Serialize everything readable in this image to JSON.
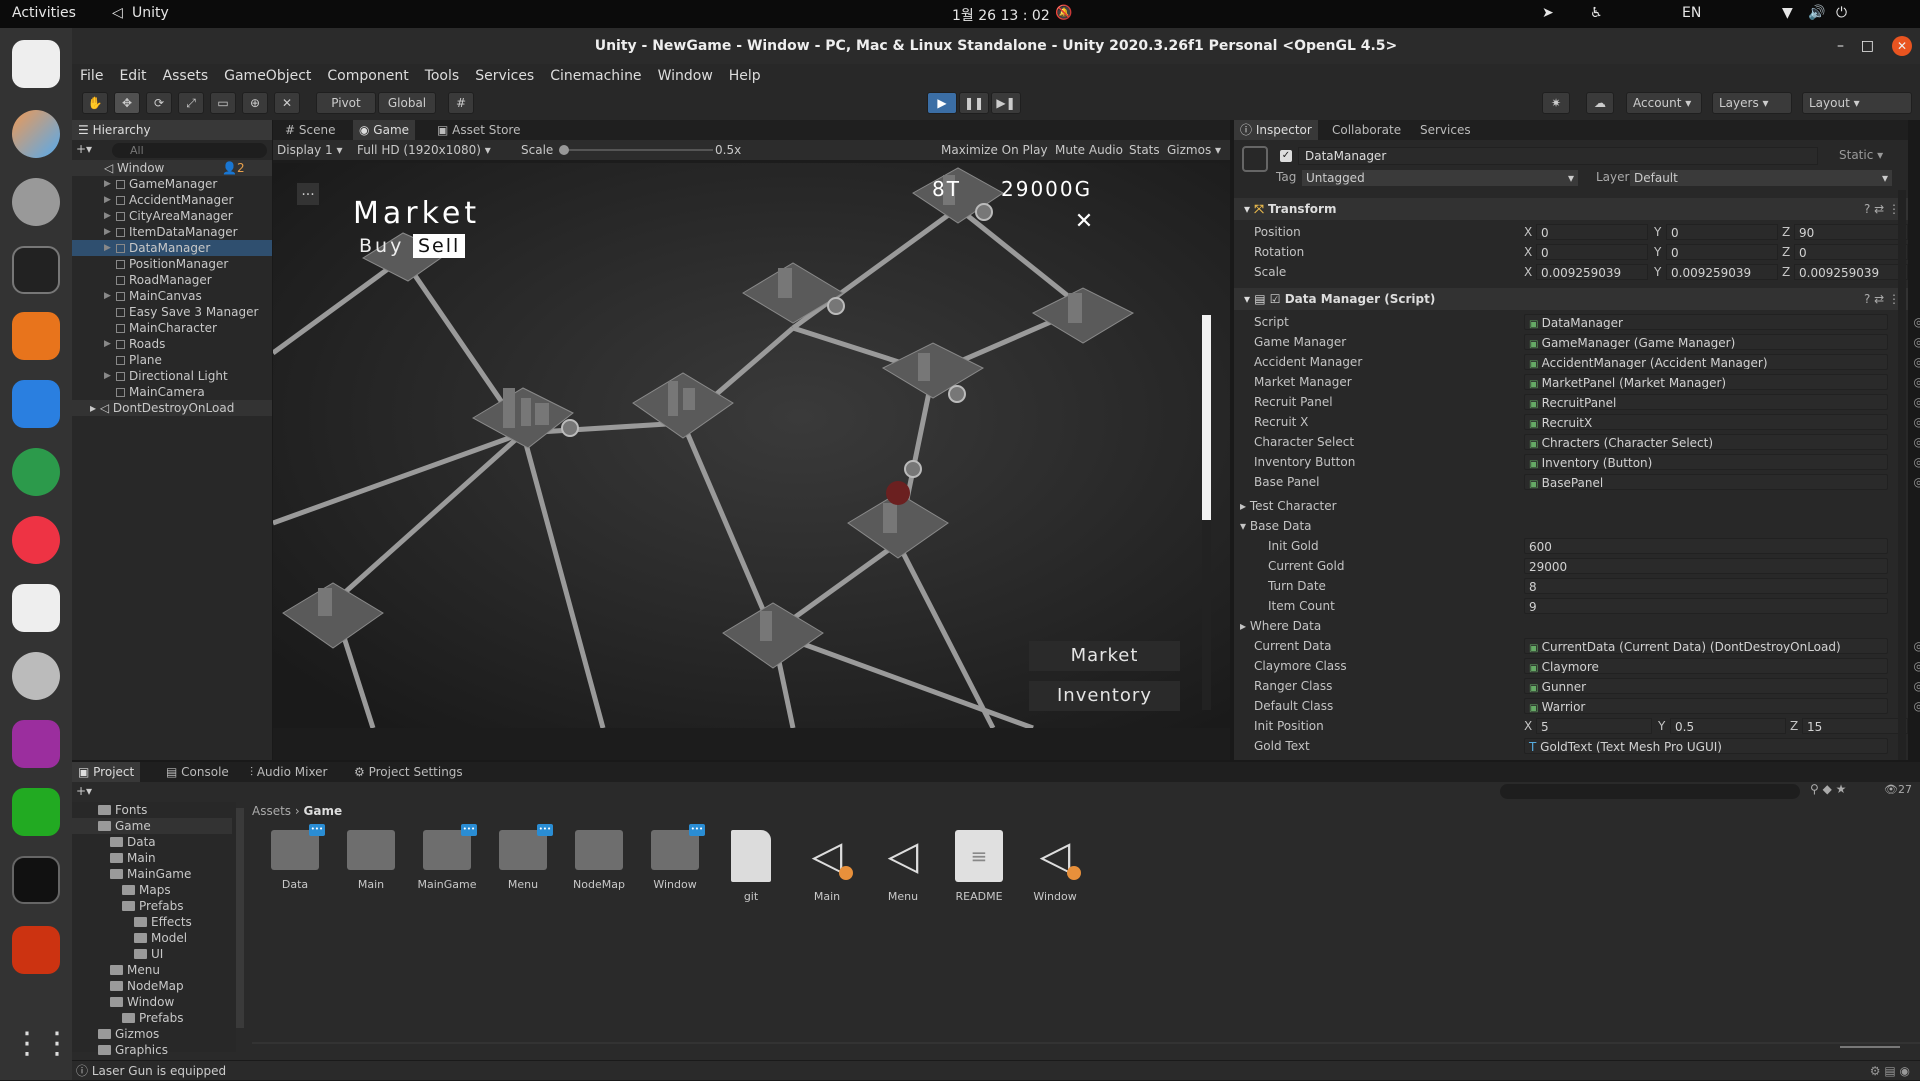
{
  "topbar": {
    "activities": "Activities",
    "app": "Unity",
    "clock": "1월 26 13 : 02",
    "lang": "EN"
  },
  "window": {
    "title": "Unity - NewGame - Window - PC, Mac & Linux Standalone - Unity 2020.3.26f1 Personal <OpenGL 4.5>"
  },
  "menu": [
    "File",
    "Edit",
    "Assets",
    "GameObject",
    "Component",
    "Tools",
    "Services",
    "Cinemachine",
    "Window",
    "Help"
  ],
  "toolbar": {
    "pivot": "Pivot",
    "global": "Global",
    "account": "Account",
    "layers": "Layers",
    "layout": "Layout"
  },
  "hierarchy": {
    "tab": "Hierarchy",
    "search": "All",
    "scene": "Window",
    "scene_badge": "2",
    "items": [
      "GameManager",
      "AccidentManager",
      "CityAreaManager",
      "ItemDataManager",
      "DataManager",
      "PositionManager",
      "RoadManager",
      "MainCanvas",
      "Easy Save 3 Manager",
      "MainCharacter",
      "Roads",
      "Plane",
      "Directional Light",
      "MainCamera"
    ],
    "dont_destroy": "DontDestroyOnLoad"
  },
  "game": {
    "tabs": [
      "Scene",
      "Game",
      "Asset Store"
    ],
    "display": "Display 1",
    "resolution": "Full HD (1920x1080)",
    "scale_label": "Scale",
    "scale_value": "0.5x",
    "options": [
      "Maximize On Play",
      "Mute Audio",
      "Stats",
      "Gizmos"
    ],
    "market_title": "Market",
    "buy": "Buy",
    "sell": "Sell",
    "turn": "8T",
    "gold": "29000G",
    "market_btn": "Market",
    "inventory_btn": "Inventory",
    "dots": "..."
  },
  "inspector": {
    "tabs": [
      "Inspector",
      "Collaborate",
      "Services"
    ],
    "object_name": "DataManager",
    "static": "Static",
    "tag_label": "Tag",
    "tag": "Untagged",
    "layer_label": "Layer",
    "layer": "Default",
    "transform": {
      "title": "Transform",
      "rows": [
        {
          "label": "Position",
          "x": "0",
          "y": "0",
          "z": "90"
        },
        {
          "label": "Rotation",
          "x": "0",
          "y": "0",
          "z": "0"
        },
        {
          "label": "Scale",
          "x": "0.009259039",
          "y": "0.009259039",
          "z": "0.009259039"
        }
      ]
    },
    "script_title": "Data Manager (Script)",
    "fields": [
      {
        "label": "Script",
        "value": "DataManager"
      },
      {
        "label": "Game Manager",
        "value": "GameManager (Game Manager)"
      },
      {
        "label": "Accident Manager",
        "value": "AccidentManager (Accident Manager)"
      },
      {
        "label": "Market Manager",
        "value": "MarketPanel (Market Manager)"
      },
      {
        "label": "Recruit Panel",
        "value": "RecruitPanel"
      },
      {
        "label": "Recruit X",
        "value": "RecruitX"
      },
      {
        "label": "Character Select",
        "value": "Chracters (Character Select)"
      },
      {
        "label": "Inventory Button",
        "value": "Inventory (Button)"
      },
      {
        "label": "Base Panel",
        "value": "BasePanel"
      }
    ],
    "test_character": "Test Character",
    "base_data": "Base Data",
    "base_fields": [
      {
        "label": "Init Gold",
        "value": "600"
      },
      {
        "label": "Current Gold",
        "value": "29000"
      },
      {
        "label": "Turn Date",
        "value": "8"
      },
      {
        "label": "Item Count",
        "value": "9"
      }
    ],
    "where_data": "Where Data",
    "fields2": [
      {
        "label": "Current Data",
        "value": "CurrentData (Current Data) (DontDestroyOnLoad)"
      },
      {
        "label": "Claymore Class",
        "value": "Claymore"
      },
      {
        "label": "Ranger Class",
        "value": "Gunner"
      },
      {
        "label": "Default Class",
        "value": "Warrior"
      }
    ],
    "init_position": {
      "label": "Init Position",
      "x": "5",
      "y": "0.5",
      "z": "15"
    },
    "gold_text": {
      "label": "Gold Text",
      "value": "GoldText (Text Mesh Pro UGUI)"
    }
  },
  "project": {
    "tabs": [
      "Project",
      "Console",
      "Audio Mixer",
      "Project Settings"
    ],
    "count": "27",
    "breadcrumb": [
      "Assets",
      "Game"
    ],
    "tree": [
      {
        "n": "Fonts",
        "d": 1
      },
      {
        "n": "Game",
        "d": 1
      },
      {
        "n": "Data",
        "d": 2
      },
      {
        "n": "Main",
        "d": 2
      },
      {
        "n": "MainGame",
        "d": 2
      },
      {
        "n": "Maps",
        "d": 3
      },
      {
        "n": "Prefabs",
        "d": 3
      },
      {
        "n": "Effects",
        "d": 4
      },
      {
        "n": "Model",
        "d": 4
      },
      {
        "n": "UI",
        "d": 4
      },
      {
        "n": "Menu",
        "d": 2
      },
      {
        "n": "NodeMap",
        "d": 2
      },
      {
        "n": "Window",
        "d": 2
      },
      {
        "n": "Prefabs",
        "d": 3
      },
      {
        "n": "Gizmos",
        "d": 1
      },
      {
        "n": "Graphics",
        "d": 1
      }
    ],
    "assets": [
      "Data",
      "Main",
      "MainGame",
      "Menu",
      "NodeMap",
      "Window",
      "git",
      "Main",
      "Menu",
      "README",
      "Window"
    ]
  },
  "status": {
    "message": "Laser Gun is equipped"
  }
}
